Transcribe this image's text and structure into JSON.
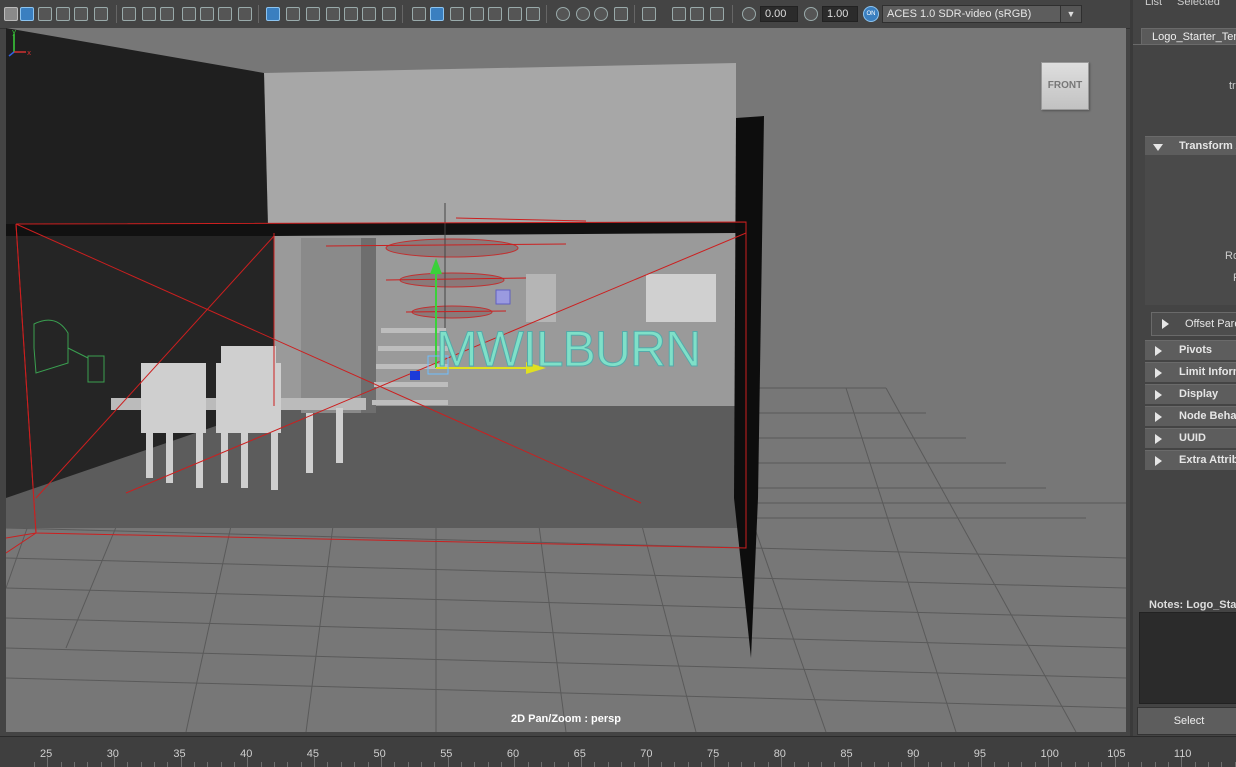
{
  "toolbar": {
    "exposure_value": "0.00",
    "gamma_value": "1.00",
    "color_management_badge": "ON",
    "color_space": "ACES 1.0 SDR-video (sRGB)"
  },
  "viewport": {
    "hud_label": "2D Pan/Zoom : persp",
    "viewcube_label": "FRONT",
    "logo_text": "MWILBURN",
    "axis_x": "x",
    "axis_y": "y",
    "axis_z": "z"
  },
  "attribute_editor": {
    "menu_list": "List",
    "menu_selected": "Selected",
    "node_tab": "Logo_Starter_Tem",
    "trunc_label_top": "tr",
    "trunc_label_rot": "Ro",
    "trunc_label_r": "R",
    "sections": {
      "transform": "Transform A",
      "offset_parent": "Offset Pare",
      "pivots": "Pivots",
      "limit_information": "Limit Inform",
      "display": "Display",
      "node_behavior": "Node Behav",
      "uuid": "UUID",
      "extra_attributes": "Extra Attrib"
    },
    "notes_label": "Notes:  Logo_Star",
    "select_button": "Select"
  },
  "timeline": {
    "labels": [
      "25",
      "30",
      "35",
      "40",
      "45",
      "50",
      "55",
      "60",
      "65",
      "70",
      "75",
      "80",
      "85",
      "90",
      "95",
      "100",
      "105",
      "110"
    ]
  },
  "colors": {
    "viewport_bg": "#777777",
    "selection_red": "#cc1f1f",
    "logo_green": "#7fe0c8"
  }
}
